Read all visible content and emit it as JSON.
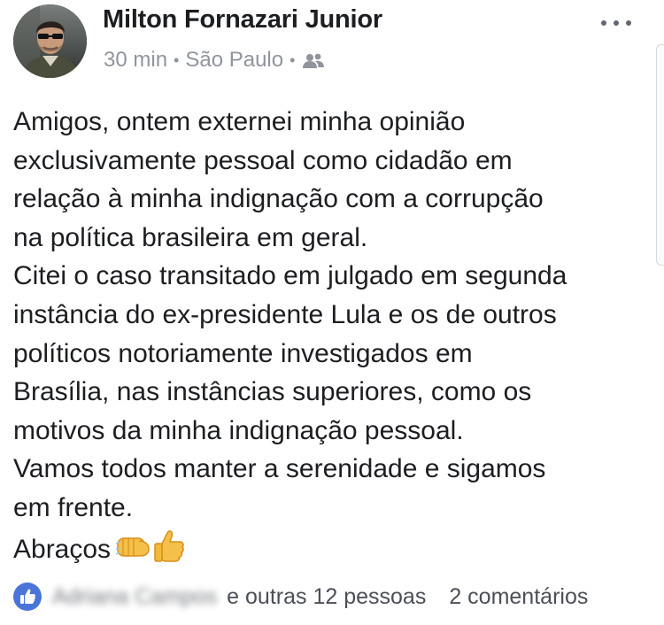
{
  "post": {
    "author": "Milton Fornazari Junior",
    "time": "30 min",
    "separator": "•",
    "location": "São Paulo",
    "audience_icon": "friends-icon",
    "more_icon": "more-options-icon",
    "text_lines": [
      "Amigos, ontem externei minha opinião",
      "exclusivamente pessoal como cidadão em",
      "relação à minha indignação com a corrupção",
      "na política brasileira em geral.",
      "Citei o caso transitado em julgado em segunda",
      "instância do ex-presidente Lula e os de outros",
      "políticos notoriamente investigados em",
      "Brasília, nas instâncias superiores, como os",
      "motivos da minha indignação pessoal.",
      "Vamos todos manter a serenidade e sigamos",
      "em frente.",
      "Abraços"
    ],
    "closing_emojis": [
      "fist-bump-emoji",
      "thumbs-up-emoji"
    ]
  },
  "footer": {
    "like_icon": "like-icon",
    "liker_name_redacted": "Adriana Campos",
    "reactions_suffix": "e outras 12 pessoas",
    "comments": "2 comentários"
  },
  "colors": {
    "text": "#1c1e21",
    "meta": "#90949c",
    "like_blue": "#4a74d8"
  }
}
